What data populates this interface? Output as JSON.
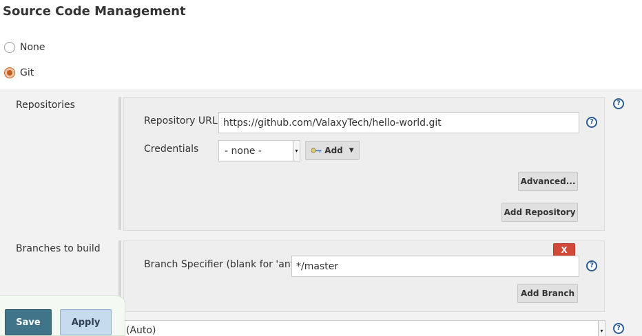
{
  "section": {
    "title": "Source Code Management"
  },
  "scm_options": [
    {
      "label": "None",
      "selected": false
    },
    {
      "label": "Git",
      "selected": true
    }
  ],
  "repositories": {
    "label": "Repositories",
    "url_label": "Repository URL",
    "url_value": "https://github.com/ValaxyTech/hello-world.git",
    "credentials_label": "Credentials",
    "credentials_value": "- none -",
    "add_label": "Add",
    "advanced_label": "Advanced...",
    "add_repository_label": "Add Repository"
  },
  "branches": {
    "label": "Branches to build",
    "specifier_label": "Branch Specifier (blank for 'any')",
    "specifier_value": "*/master",
    "delete_label": "X",
    "add_branch_label": "Add Branch"
  },
  "repo_browser": {
    "value": "(Auto)"
  },
  "footer": {
    "save_label": "Save",
    "apply_label": "Apply"
  },
  "help_icon_glyph": "?",
  "icons": {
    "help": "help-icon",
    "key": "key-icon",
    "caret": "caret-down-icon"
  },
  "colors": {
    "radio_selected": "#c35d24",
    "help": "#2a5b94",
    "delete": "#d24939",
    "save": "#3f7489",
    "apply": "#c7dbef"
  }
}
